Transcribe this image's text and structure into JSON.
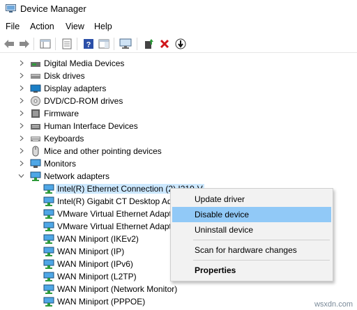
{
  "window": {
    "title": "Device Manager"
  },
  "menu": [
    "File",
    "Action",
    "View",
    "Help"
  ],
  "toolbar": {
    "buttons": [
      "back-icon",
      "forward-icon",
      "show-hide-console-tree-icon",
      "properties-icon",
      "help-icon",
      "action-pane-icon",
      "monitor-icon",
      "update-driver-icon",
      "uninstall-icon",
      "disable-icon"
    ]
  },
  "tree": {
    "categories": [
      "Digital Media Devices",
      "Disk drives",
      "Display adapters",
      "DVD/CD-ROM drives",
      "Firmware",
      "Human Interface Devices",
      "Keyboards",
      "Mice and other pointing devices",
      "Monitors",
      "Network adapters"
    ],
    "network_adapters": [
      "Intel(R) Ethernet Connection (2) I219-V",
      "Intel(R) Gigabit CT Desktop Ad",
      "VMware Virtual Ethernet Adapt",
      "VMware Virtual Ethernet Adapt",
      "WAN Miniport (IKEv2)",
      "WAN Miniport (IP)",
      "WAN Miniport (IPv6)",
      "WAN Miniport (L2TP)",
      "WAN Miniport (Network Monitor)",
      "WAN Miniport (PPPOE)"
    ]
  },
  "context_menu": {
    "update_driver": "Update driver",
    "disable_device": "Disable device",
    "uninstall_device": "Uninstall device",
    "scan_hardware": "Scan for hardware changes",
    "properties": "Properties"
  },
  "watermark": "wsxdn.com",
  "colors": {
    "selection": "#cce8ff",
    "menu_hover": "#91c9f7",
    "menu_bg": "#f2f2f2"
  }
}
